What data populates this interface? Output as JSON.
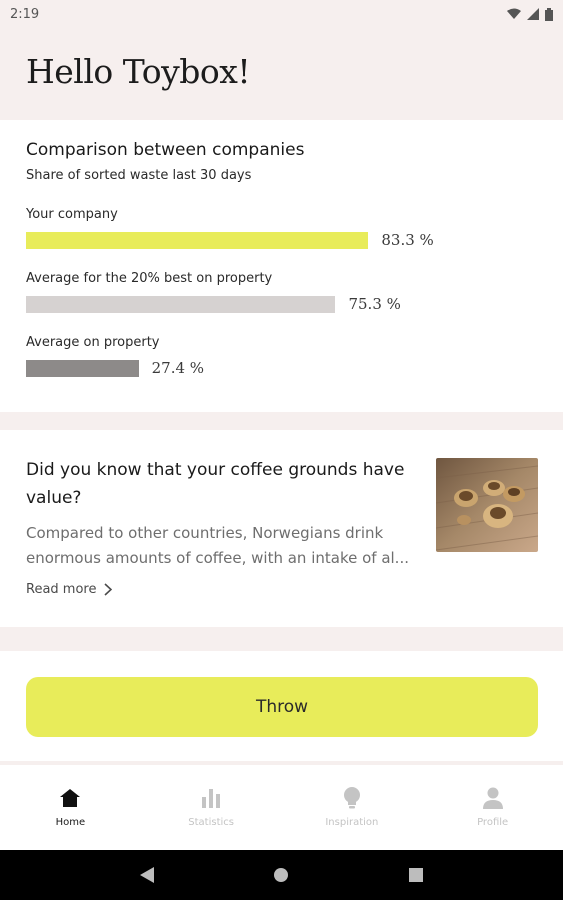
{
  "status_bar": {
    "time": "2:19"
  },
  "header": {
    "greeting": "Hello Toybox!"
  },
  "comparison": {
    "title": "Comparison between companies",
    "subtitle": "Share of sorted waste last 30 days",
    "bars": [
      {
        "label": "Your company",
        "value_text": "83.3 %",
        "value": 83.3,
        "color": "#e8ec5a"
      },
      {
        "label": "Average for the 20% best on property",
        "value_text": "75.3 %",
        "value": 75.3,
        "color": "#d6d2d1"
      },
      {
        "label": "Average on property",
        "value_text": "27.4 %",
        "value": 27.4,
        "color": "#8d8a89"
      }
    ]
  },
  "tip": {
    "title": "Did you know that your coffee grounds have value?",
    "body": "Compared to other countries, Norwegians drink enormous amounts of coffee, with an intake of al...",
    "read_more": "Read more"
  },
  "actions": {
    "throw_label": "Throw"
  },
  "bottom_nav": {
    "items": [
      {
        "label": "Home",
        "icon": "home-icon"
      },
      {
        "label": "Statistics",
        "icon": "bar-chart-icon"
      },
      {
        "label": "Inspiration",
        "icon": "lightbulb-icon"
      },
      {
        "label": "Profile",
        "icon": "person-icon"
      }
    ]
  },
  "colors": {
    "accent": "#e8ec5a",
    "background": "#f6efee"
  }
}
